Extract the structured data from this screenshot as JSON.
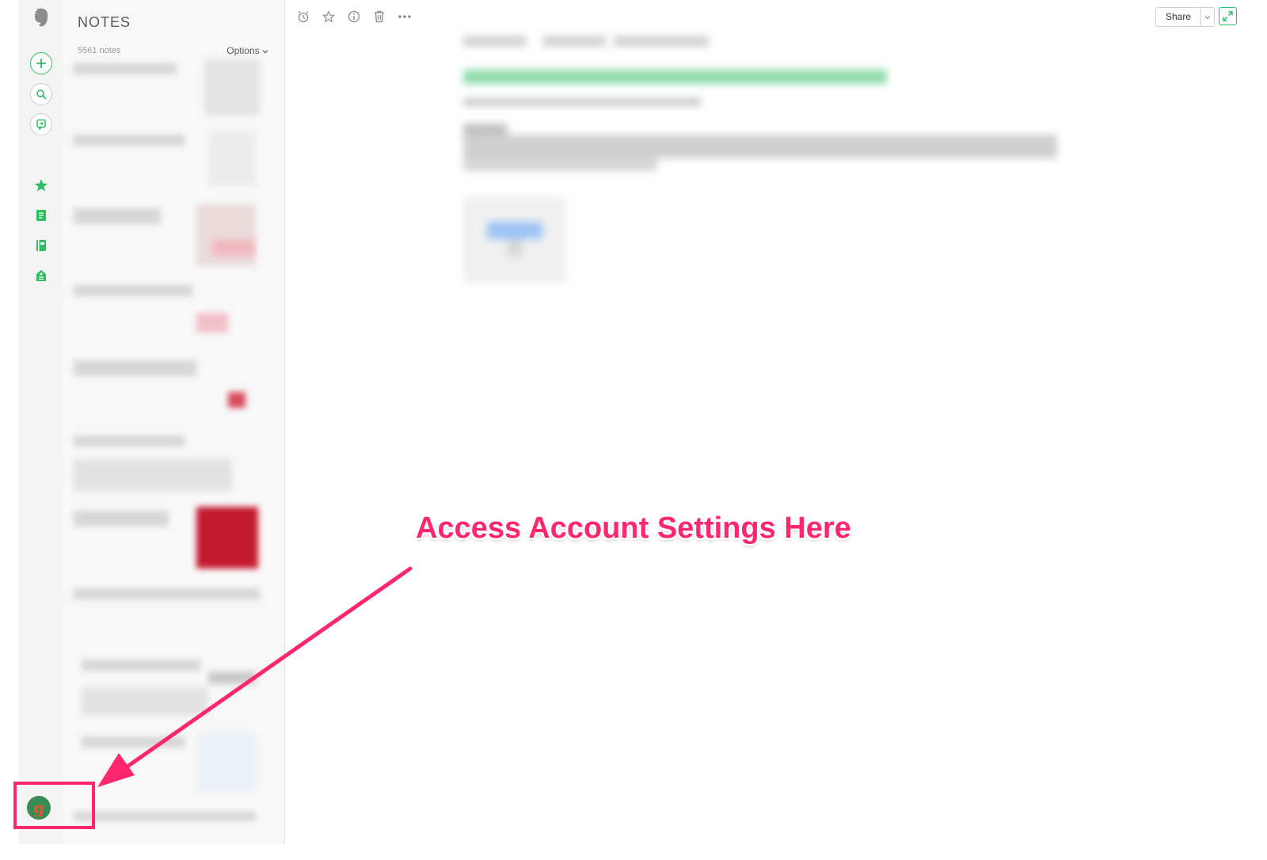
{
  "sidebar": {
    "items": [
      {
        "icon": "evernote-logo-icon"
      },
      {
        "icon": "plus-icon"
      },
      {
        "icon": "search-icon"
      },
      {
        "icon": "work-chat-icon"
      },
      {
        "icon": "star-icon"
      },
      {
        "icon": "notes-icon"
      },
      {
        "icon": "notebooks-icon"
      },
      {
        "icon": "tags-icon"
      }
    ],
    "avatar_letter": "g"
  },
  "note_list": {
    "title": "NOTES",
    "count": "5561 notes",
    "options_label": "Options"
  },
  "toolbar": {
    "icons": [
      "reminder-icon",
      "star-icon",
      "info-icon",
      "trash-icon",
      "more-icon"
    ],
    "share_label": "Share"
  },
  "annotation": {
    "text": "Access Account Settings Here"
  },
  "colors": {
    "accent": "#2dbe60",
    "annotation": "#ff2670"
  }
}
